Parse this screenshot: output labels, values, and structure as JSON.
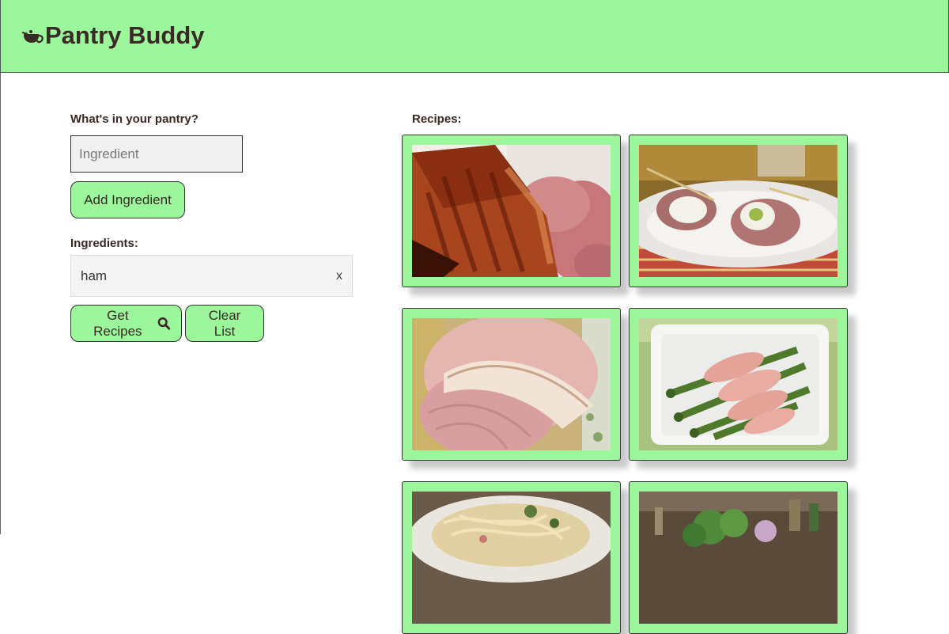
{
  "header": {
    "app_title": "Pantry Buddy",
    "brand_icon": "cooking-pot-icon",
    "background_color": "#9cf79c"
  },
  "pantry": {
    "question_label": "What's in your pantry?",
    "input_placeholder": "Ingredient",
    "input_value": "",
    "add_button_label": "Add Ingredient"
  },
  "ingredients": {
    "label": "Ingredients:",
    "items": [
      {
        "name": "ham",
        "remove_label": "x"
      }
    ]
  },
  "actions": {
    "get_recipes_label": "Get Recipes",
    "get_recipes_icon": "search-icon",
    "clear_list_label": "Clear List"
  },
  "recipes": {
    "label": "Recipes:",
    "cards": [
      {
        "image": "glazed-ham-slices-photo"
      },
      {
        "image": "ham-cream-cheese-pickle-rolls-photo"
      },
      {
        "image": "spiral-ham-photo"
      },
      {
        "image": "asparagus-ham-roll-ups-photo"
      },
      {
        "image": "ham-pasta-photo"
      },
      {
        "image": "herb-garden-dish-photo"
      }
    ]
  },
  "colors": {
    "accent": "#9cf79c",
    "text": "#3a2a25"
  }
}
